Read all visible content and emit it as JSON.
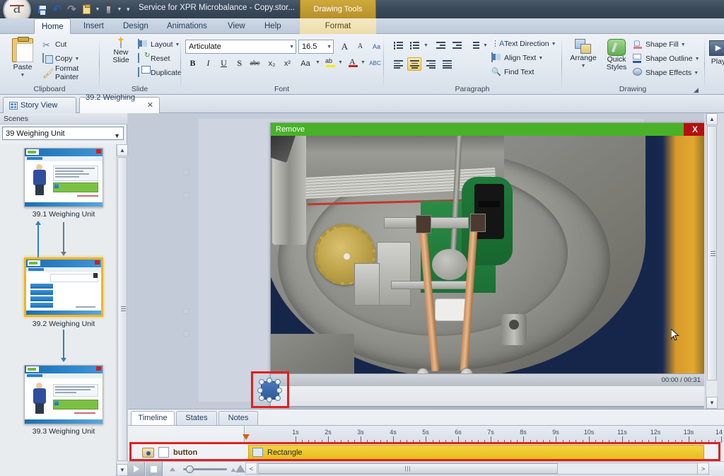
{
  "window": {
    "title": "Service for XPR Microbalance - Copy.stor...",
    "contextual_tab_group": "Drawing Tools"
  },
  "quick_access": [
    {
      "name": "save-icon",
      "label": "Save"
    },
    {
      "name": "undo-icon",
      "label": "Undo"
    },
    {
      "name": "redo-icon",
      "label": "Redo"
    },
    {
      "name": "paste-icon",
      "label": "Paste"
    },
    {
      "name": "format-painter-icon",
      "label": "Format Painter"
    }
  ],
  "ribbon_tabs": [
    {
      "label": "Home",
      "active": true
    },
    {
      "label": "Insert",
      "active": false
    },
    {
      "label": "Design",
      "active": false
    },
    {
      "label": "Animations",
      "active": false
    },
    {
      "label": "View",
      "active": false
    },
    {
      "label": "Help",
      "active": false
    },
    {
      "label": "Format",
      "active": false,
      "contextual": true
    }
  ],
  "ribbon": {
    "clipboard": {
      "label": "Clipboard",
      "paste": "Paste",
      "cut": "Cut",
      "copy": "Copy",
      "format_painter": "Format Painter"
    },
    "slide": {
      "label": "Slide",
      "new_slide": "New\nSlide",
      "new_slide_line1": "New",
      "new_slide_line2": "Slide",
      "layout": "Layout",
      "reset": "Reset",
      "duplicate": "Duplicate"
    },
    "font": {
      "label": "Font",
      "font_name": "Articulate",
      "font_size": "16.5",
      "grow_font": "A",
      "shrink_font": "A",
      "clear_formatting": "Aa",
      "bold": "B",
      "italic": "I",
      "underline": "U",
      "shadow": "S",
      "strikethrough": "abc",
      "subscript": "x₂",
      "superscript": "x²",
      "change_case": "Aa",
      "highlight": "ab",
      "font_color": "A",
      "spelling": "ABC"
    },
    "paragraph": {
      "label": "Paragraph",
      "bullets": "Bullets",
      "numbering": "Numbering",
      "decrease_indent": "Decrease Indent",
      "increase_indent": "Increase Indent",
      "line_spacing": "Line Spacing",
      "text_direction": "Text Direction",
      "align_text": "Align Text",
      "find_text": "Find Text",
      "align_left": "Align Left",
      "align_center": "Center",
      "align_right": "Align Right",
      "justify": "Justify"
    },
    "drawing": {
      "label": "Drawing",
      "arrange": "Arrange",
      "quick_styles_line1": "Quick",
      "quick_styles_line2": "Styles",
      "shape_fill": "Shape Fill",
      "shape_outline": "Shape Outline",
      "shape_effects": "Shape Effects"
    },
    "publish": {
      "play_label": "Play"
    }
  },
  "doc_tabs": [
    {
      "label": "Story View",
      "active": false,
      "closable": false
    },
    {
      "label": "39.2 Weighing ...",
      "active": true,
      "closable": true
    }
  ],
  "left_panel": {
    "header": "Scenes",
    "scene_selected": "39 Weighing Unit",
    "slides": [
      {
        "label": "39.1 Weighing Unit",
        "selected": false
      },
      {
        "label": "39.2 Weighing Unit",
        "selected": true
      },
      {
        "label": "39.3 Weighing Unit",
        "selected": false
      }
    ]
  },
  "slide_canvas": {
    "video": {
      "header_title": "Remove",
      "close_label": "X",
      "time_display": "00:00 / 00:31",
      "header_color": "#49b127",
      "close_color": "#b50f0f"
    }
  },
  "timeline": {
    "tabs": [
      {
        "label": "Timeline",
        "active": true
      },
      {
        "label": "States",
        "active": false
      },
      {
        "label": "Notes",
        "active": false
      }
    ],
    "tracks": [
      {
        "label": "button",
        "object_label": "Rectangle",
        "highlighted": true
      }
    ],
    "ruler_ticks": [
      "1s",
      "2s",
      "3s",
      "4s",
      "5s",
      "6s",
      "7s",
      "8s",
      "9s",
      "10s",
      "11s",
      "12s",
      "13s",
      "14"
    ],
    "controls": {
      "play": "Play",
      "stop": "Stop",
      "zoom_out": "Zoom Out",
      "zoom_in": "Zoom In",
      "scroll_left": "<",
      "scroll_right": ">",
      "scroll_grip": "|||"
    },
    "highlight_color": "#e02020",
    "bar_color": "#e8be1f"
  }
}
